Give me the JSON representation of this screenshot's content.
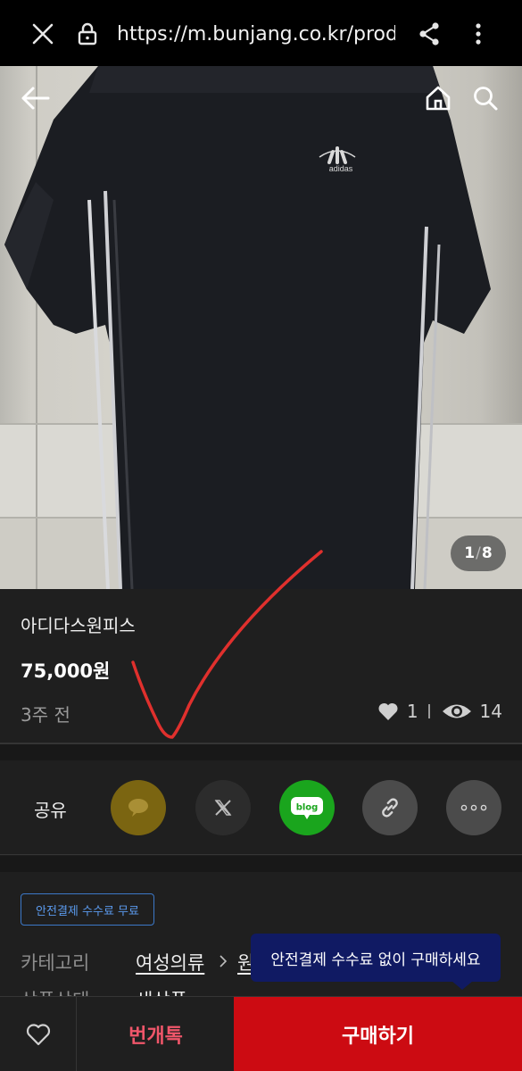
{
  "browser": {
    "url": "https://m.bunjang.co.kr/prod"
  },
  "photo": {
    "logo_text": "adidas",
    "counter_current": "1",
    "counter_separator": "/",
    "counter_total": "8"
  },
  "product": {
    "title": "아디다스원피스",
    "price": "75,000원",
    "posted": "3주 전",
    "likes": "1",
    "views": "14"
  },
  "share": {
    "label": "공유",
    "blog_text": "blog",
    "buttons": [
      {
        "icon": "kakaotalk-icon",
        "color": "#7b6511"
      },
      {
        "icon": "x-icon",
        "color": "#2c2c2c"
      },
      {
        "icon": "naver-blog-icon",
        "color": "#1aa51d"
      },
      {
        "icon": "link-icon",
        "color": "#4b4b4b"
      },
      {
        "icon": "more-icon",
        "color": "#4b4b4b"
      }
    ]
  },
  "detail": {
    "badge": "안전결제 수수료 무료",
    "category_label": "카테고리",
    "category_value": "여성의류",
    "category_sub": "원",
    "condition_label": "상품상태",
    "condition_value": "새상품"
  },
  "tooltip": "안전결제 수수료 없이 구매하세요",
  "bottom": {
    "chat_label": "번개톡",
    "buy_label": "구매하기"
  },
  "colors": {
    "accent_red": "#cc0b12",
    "chat_pink": "#f0566a",
    "badge_blue": "#3c78c8",
    "tooltip_navy": "#101a63",
    "annotation_red": "#e0302d"
  }
}
